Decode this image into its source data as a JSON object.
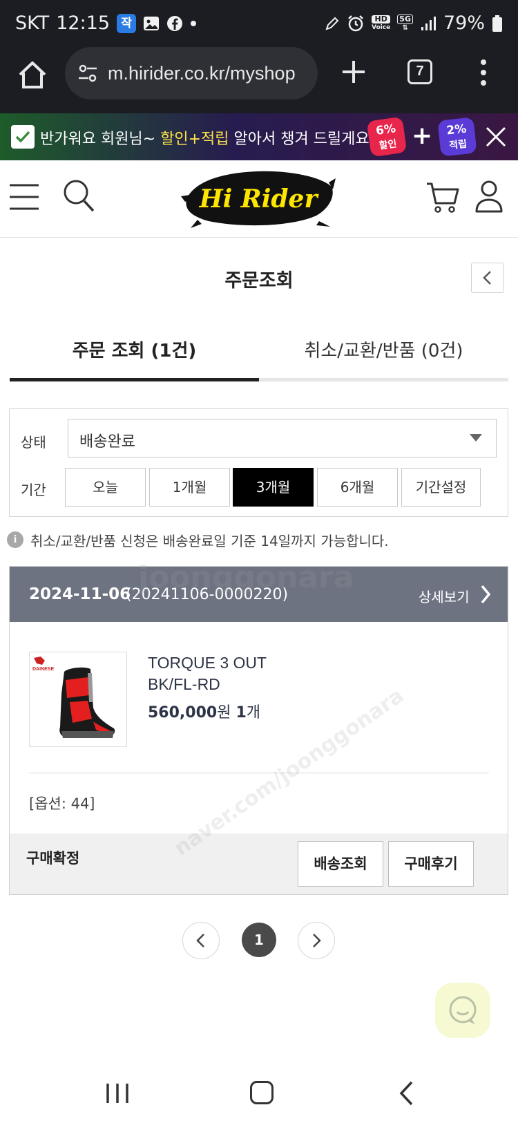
{
  "status_bar": {
    "carrier": "SKT",
    "time": "12:15",
    "app_badge": "작",
    "hd_label": "HD",
    "voice_label": "Voice",
    "net_label": "5G",
    "battery": "79%"
  },
  "browser": {
    "url": "m.hirider.co.kr/myshop",
    "tab_count": "7"
  },
  "promo": {
    "greeting": "반가워요 회원님~ ",
    "highlight": "할인+적립",
    "tail": " 알아서 챙겨 드릴게요!",
    "badge1_top": "6%",
    "badge1_bottom": "할인",
    "badge2_top": "2%",
    "badge2_bottom": "적립"
  },
  "header": {
    "logo_text": "Hi Rider"
  },
  "page": {
    "title": "주문조회"
  },
  "tabs": [
    {
      "label": "주문 조회 (1건)"
    },
    {
      "label": "취소/교환/반품 (0건)"
    }
  ],
  "filter": {
    "status_label": "상태",
    "status_value": "배송완료",
    "period_label": "기간",
    "periods": [
      "오늘",
      "1개월",
      "3개월",
      "6개월",
      "기간설정"
    ],
    "active_period": "3개월"
  },
  "notice": {
    "icon": "i",
    "text": "취소/교환/반품 신청은 배송완료일 기준 14일까지 가능합니다."
  },
  "order": {
    "date": "2024-11-06",
    "order_no": "(20241106-0000220)",
    "detail_link": "상세보기",
    "product_brand": "DAINESE",
    "product_name_line1": "TORQUE 3 OUT",
    "product_name_line2": "BK/FL-RD",
    "price": "560,000",
    "currency": "원",
    "qty": "1",
    "qty_unit": "개",
    "option": "[옵션: 44]",
    "status": "구매확정",
    "btn_tracking": "배송조회",
    "btn_review": "구매후기"
  },
  "pagination": {
    "current": "1"
  },
  "watermark": {
    "line1": "joonggonara",
    "line2": "naver.com/joonggonara"
  },
  "colors": {
    "status_bar_bg": "#1c1d22",
    "order_header_bg": "#6e7382",
    "active_period_bg": "#000000",
    "pager_active_bg": "#4a4a4a",
    "chat_fab_bg": "#f7f9d2",
    "promo_highlight": "#ffe34a"
  },
  "icons": {
    "home": "home-icon",
    "url_settings": "tune-icon",
    "new_tab": "plus-icon",
    "more": "more-vert-icon",
    "menu": "hamburger-icon",
    "search": "search-icon",
    "cart": "cart-icon",
    "user": "user-icon",
    "back": "chevron-left-icon",
    "chat": "chat-icon"
  }
}
